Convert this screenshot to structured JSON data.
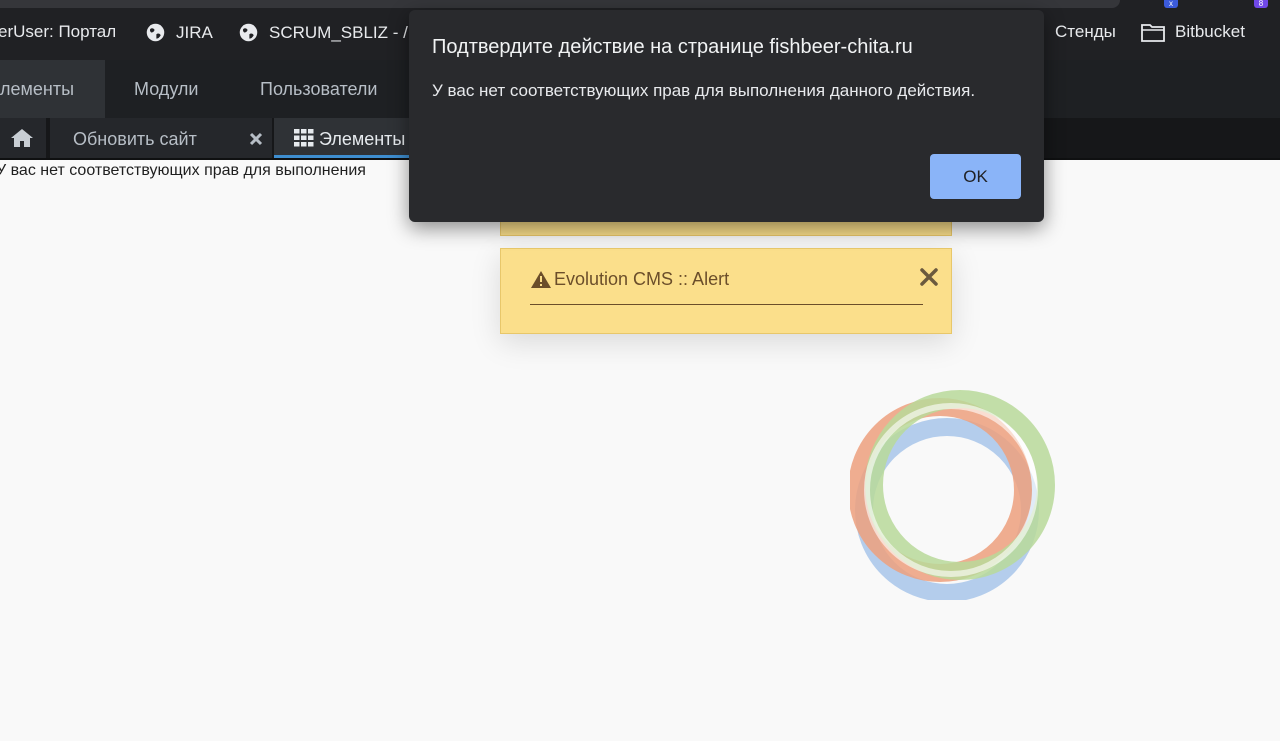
{
  "bookmarks": {
    "items": [
      {
        "label": "erUser: Портал"
      },
      {
        "label": "JIRA"
      },
      {
        "label": "SCRUM_SBLIZ - /"
      },
      {
        "label": "Стенды"
      },
      {
        "label": "Bitbucket"
      }
    ]
  },
  "extension_badges": [
    "x",
    "8"
  ],
  "menu": {
    "items": [
      {
        "label": "лементы"
      },
      {
        "label": "Модули"
      },
      {
        "label": "Пользователи"
      }
    ]
  },
  "tabs": {
    "items": [
      {
        "label": "Обновить сайт"
      },
      {
        "label": "Элементы"
      }
    ]
  },
  "page_message": "У вас нет соответствующих прав для выполнения",
  "alert": {
    "title": "Evolution CMS :: Alert",
    "color": "#fbdf8b"
  },
  "dialog": {
    "title": "Подтвердите действие на странице fishbeer-chita.ru",
    "message": "У вас нет соответствующих прав для выполнения данного действия.",
    "ok_label": "OK",
    "button_color": "#8ab4f8"
  }
}
